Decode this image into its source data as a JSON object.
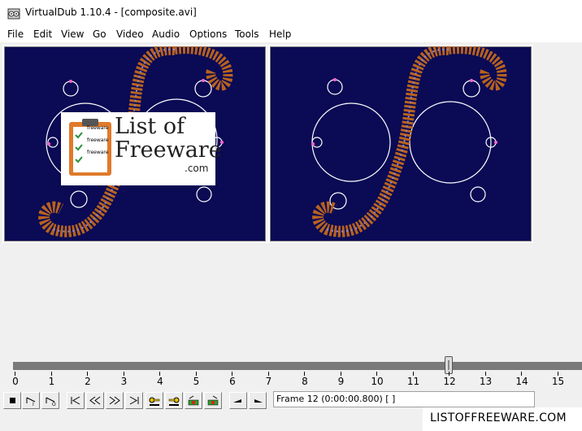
{
  "window": {
    "title": "VirtualDub 1.10.4 - [composite.avi]",
    "icon": "film-reel-icon"
  },
  "menu": {
    "items": [
      "File",
      "Edit",
      "View",
      "Go",
      "Video",
      "Audio",
      "Options",
      "Tools",
      "Help"
    ]
  },
  "panes": {
    "input": {
      "background": "#0a0a55"
    },
    "output": {
      "background": "#0a0a55"
    }
  },
  "logo": {
    "title_line1": "List of",
    "title_line2": "Freeware",
    "domain": ".com",
    "badge_lines": [
      "freeware",
      "freeware",
      "freeware"
    ]
  },
  "timeline": {
    "tick_labels": [
      "0",
      "1",
      "2",
      "3",
      "4",
      "5",
      "6",
      "7",
      "8",
      "9",
      "10",
      "11",
      "12",
      "13",
      "14",
      "15"
    ],
    "current_frame": 12,
    "max_visible_frame": 15.7
  },
  "toolbar": {
    "buttons": [
      "stop-icon",
      "play-input-icon",
      "play-output-icon",
      "go-start-icon",
      "prev-frame-icon",
      "next-frame-icon",
      "go-end-icon",
      "prev-keyframe-icon",
      "next-keyframe-icon",
      "prev-scene-icon",
      "next-scene-icon",
      "mark-in-icon",
      "mark-out-icon"
    ]
  },
  "status": {
    "frame_text": "Frame 12 (0:00:00.800) [ ]"
  },
  "watermark": {
    "text": "LISTOFFREEWARE.COM"
  }
}
